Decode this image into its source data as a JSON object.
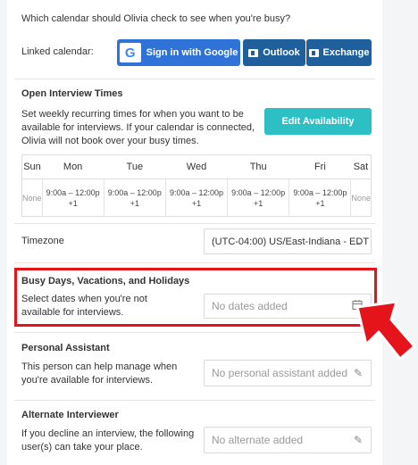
{
  "question": "Which calendar should Olivia check to see when you're busy?",
  "linked_calendar": {
    "label": "Linked calendar:",
    "google": "Sign in with Google",
    "google_letter": "G",
    "outlook": "Outlook",
    "exchange": "Exchange"
  },
  "interview_times": {
    "title": "Open Interview Times",
    "description": "Set weekly recurring times for when you want to be available for interviews. If your calendar is connected, Olivia will not book over your busy times.",
    "edit_button": "Edit Availability",
    "days": [
      "Sun",
      "Mon",
      "Tue",
      "Wed",
      "Thu",
      "Fri",
      "Sat"
    ],
    "slots": [
      "None",
      "9:00a – 12:00p +1",
      "9:00a – 12:00p +1",
      "9:00a – 12:00p +1",
      "9:00a – 12:00p +1",
      "9:00a – 12:00p +1",
      "None"
    ]
  },
  "timezone": {
    "label": "Timezone",
    "value": "(UTC-04:00) US/East-Indiana - EDT"
  },
  "busy_days": {
    "title": "Busy Days, Vacations, and Holidays",
    "description": "Select dates when you're not available for interviews.",
    "placeholder": "No dates added"
  },
  "personal_assistant": {
    "title": "Personal Assistant",
    "description": "This person can help manage when you're available for interviews.",
    "placeholder": "No personal assistant added"
  },
  "alternate_interviewer": {
    "title": "Alternate Interviewer",
    "description": "If you decline an interview, the following user(s) can take your place.",
    "placeholder": "No alternate added"
  },
  "colors": {
    "highlight": "#e5141b",
    "arrow": "#e5141b",
    "google_blue": "#2f73d8",
    "microsoft_blue": "#1f5f9b",
    "teal": "#2cbfc4"
  }
}
